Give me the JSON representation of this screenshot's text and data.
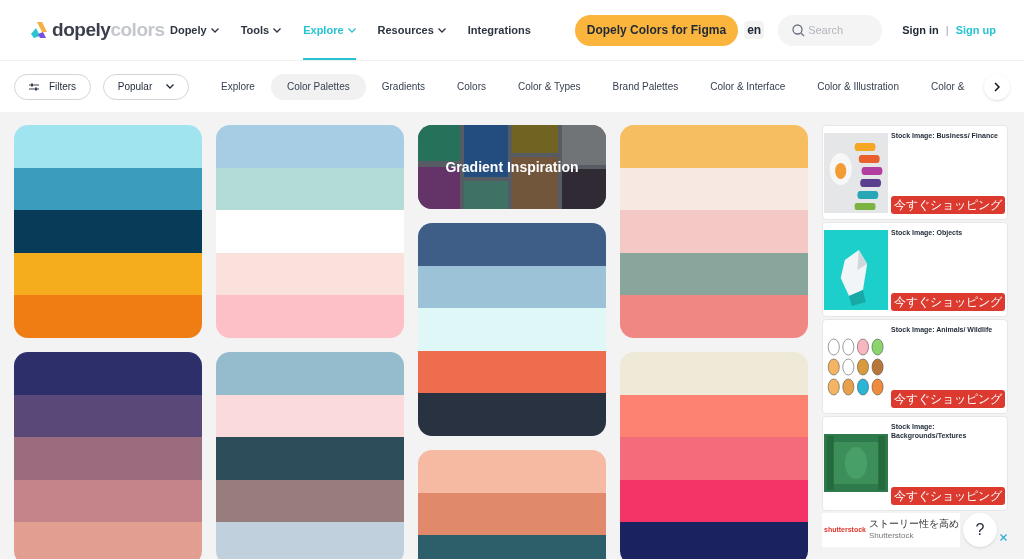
{
  "logo": {
    "brand": "dopely",
    "suffix": "colors"
  },
  "nav": [
    {
      "label": "Dopely",
      "dropdown": true,
      "selected": false
    },
    {
      "label": "Tools",
      "dropdown": true,
      "selected": false
    },
    {
      "label": "Explore",
      "dropdown": true,
      "selected": true
    },
    {
      "label": "Resources",
      "dropdown": true,
      "selected": false
    },
    {
      "label": "Integrations",
      "dropdown": false,
      "selected": false
    }
  ],
  "figma_button": "Dopely Colors for Figma",
  "language": "en",
  "search": {
    "placeholder": "Search"
  },
  "sign_in": "Sign in",
  "separator": "|",
  "sign_up": "Sign up",
  "filters_button": "Filters",
  "sort": {
    "value": "Popular"
  },
  "categories": [
    {
      "label": "Explore",
      "selected": false
    },
    {
      "label": "Color Palettes",
      "selected": true
    },
    {
      "label": "Gradients",
      "selected": false
    },
    {
      "label": "Colors",
      "selected": false
    },
    {
      "label": "Color & Types",
      "selected": false
    },
    {
      "label": "Brand Palettes",
      "selected": false
    },
    {
      "label": "Color & Interface",
      "selected": false
    },
    {
      "label": "Color & Illustration",
      "selected": false
    },
    {
      "label": "Color &",
      "selected": false
    }
  ],
  "columns": [
    {
      "cards": [
        {
          "kind": "palette",
          "swatches": [
            {
              "color": "#a0e4f0"
            },
            {
              "color": "#3b9cbe"
            },
            {
              "color": "#073b57"
            },
            {
              "color": "#f5ad1e"
            },
            {
              "color": "#f07c14"
            }
          ]
        },
        {
          "kind": "palette",
          "swatches": [
            {
              "color": "#2d2f6b"
            },
            {
              "color": "#5a4878"
            },
            {
              "color": "#9b6c7e"
            },
            {
              "color": "#c5838a"
            },
            {
              "color": "#e29f91"
            }
          ]
        }
      ]
    },
    {
      "cards": [
        {
          "kind": "palette",
          "swatches": [
            {
              "color": "#a6cde3"
            },
            {
              "color": "#b3dcd7"
            },
            {
              "color": "#ffffff"
            },
            {
              "color": "#fbe1dc"
            },
            {
              "color": "#fdc0c6"
            }
          ]
        },
        {
          "kind": "palette",
          "swatches": [
            {
              "color": "#94bccc"
            },
            {
              "color": "#fadadb"
            },
            {
              "color": "#2c4d59"
            },
            {
              "color": "#977d7d"
            },
            {
              "color": "#c0d0dc"
            }
          ]
        }
      ]
    },
    {
      "cards": [
        {
          "kind": "banner",
          "title": "Gradient Inspiration"
        },
        {
          "kind": "palette",
          "swatches": [
            {
              "color": "#3e5d87"
            },
            {
              "color": "#9cc2d8"
            },
            {
              "color": "#dff8f7"
            },
            {
              "color": "#ee6d4e"
            },
            {
              "color": "#293241"
            }
          ]
        },
        {
          "kind": "palette",
          "swatches": [
            {
              "color": "#f6b9a2"
            },
            {
              "color": "#e08a6b"
            },
            {
              "color": "#2c5f6a"
            }
          ]
        }
      ]
    },
    {
      "cards": [
        {
          "kind": "palette",
          "swatches": [
            {
              "color": "#f6be60"
            },
            {
              "color": "#f7e9e2"
            },
            {
              "color": "#f4c9c5"
            },
            {
              "color": "#89a69d"
            },
            {
              "color": "#f08783"
            }
          ]
        },
        {
          "kind": "palette",
          "swatches": [
            {
              "color": "#efe9d8"
            },
            {
              "color": "#fd8272"
            },
            {
              "color": "#f46b7c"
            },
            {
              "color": "#f43467"
            },
            {
              "color": "#1a2360"
            }
          ]
        }
      ]
    }
  ],
  "ads": [
    {
      "title": "Stock Image: Business/ Finance",
      "button": "今すぐショッピング",
      "kind": "chart"
    },
    {
      "title": "Stock Image: Objects",
      "button": "今すぐショッピング",
      "kind": "object"
    },
    {
      "title": "Stock Image: Animals/ Wildlife",
      "button": "今すぐショッピング",
      "kind": "animals"
    },
    {
      "title": "Stock Image: Backgrounds/Textures",
      "button": "今すぐショッピング",
      "kind": "texture"
    }
  ],
  "ad_banner": {
    "logo": "shutterstock",
    "headline": "ストーリー性を高め",
    "advertiser": "Shutterstock"
  },
  "help_button": "?"
}
